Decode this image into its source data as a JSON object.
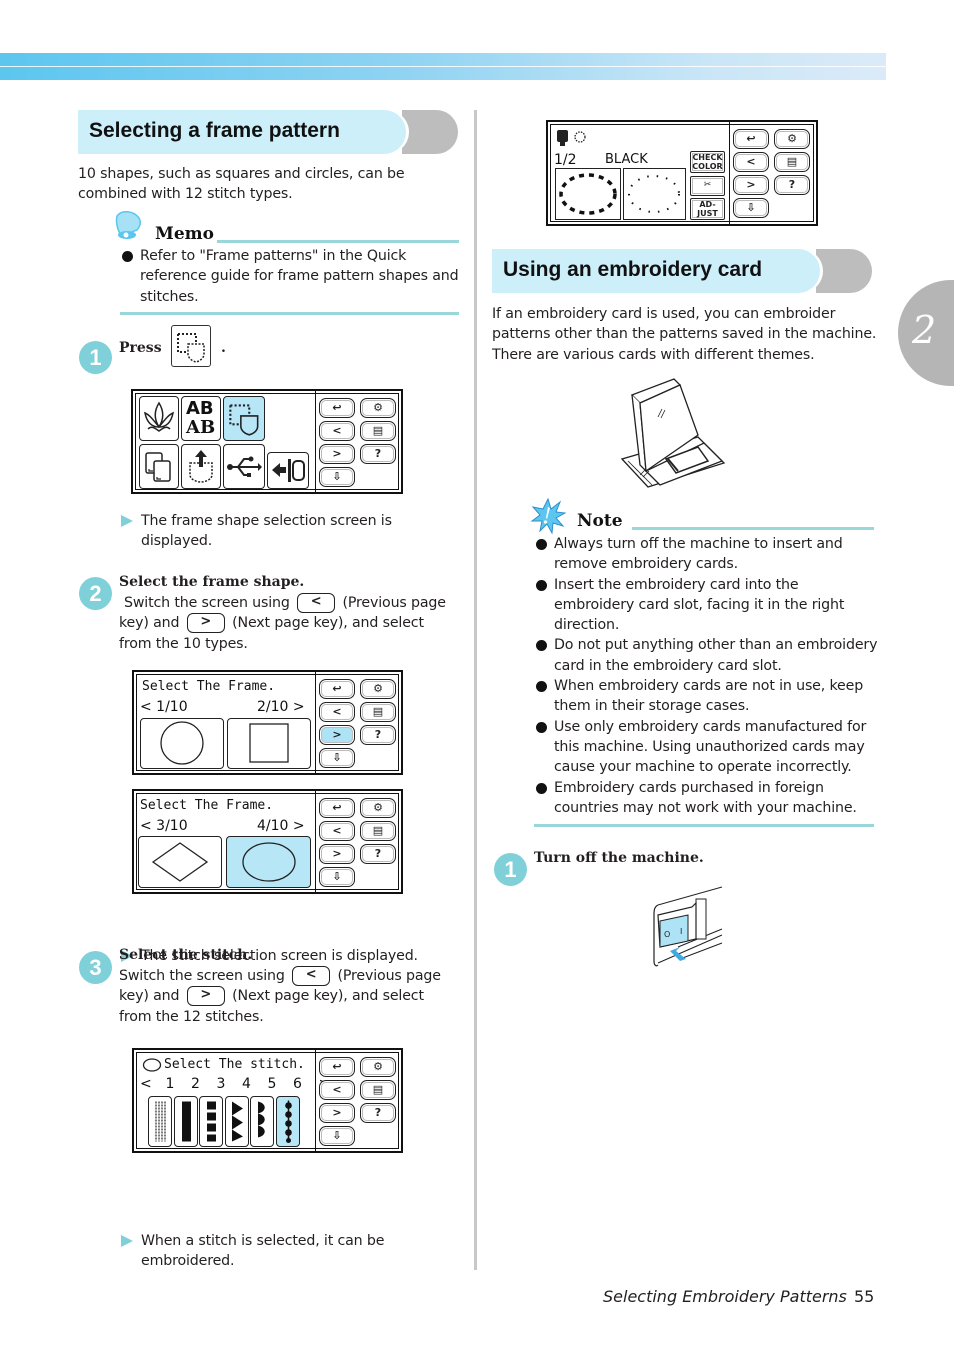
{
  "header": {
    "chapter_number": "2"
  },
  "left": {
    "section_title": "Selecting a frame pattern",
    "intro": "10 shapes, such as squares and circles, can be combined with 12 stitch types.",
    "memo": {
      "label": "Memo",
      "items": [
        "Refer to \"Frame patterns\" in the Quick reference guide for frame pattern shapes and stitches."
      ]
    },
    "step1": {
      "number": "1",
      "text_before": "Press",
      "text_after": ".",
      "result": "The frame shape selection screen is displayed."
    },
    "step2": {
      "number": "2",
      "title": "Select the frame shape.",
      "line1_before": "Switch the screen using",
      "line1_after": "(Previous page",
      "line2_before": "key) and",
      "line2_after": "(Next page key), and select",
      "line3": "from the 10 types.",
      "result": "The stitch selection screen is displayed."
    },
    "step3": {
      "number": "3",
      "title": "Select the stitch.",
      "line1_before": "Switch the screen using",
      "line1_after": "(Previous page",
      "line2_before": "key) and",
      "line2_after": "(Next page key), and select",
      "line3": "from the 12 stitches.",
      "result": "When a stitch is selected, it can be embroidered."
    }
  },
  "keys": {
    "prev": "<",
    "next": ">"
  },
  "screens": {
    "frame1": {
      "title": "Select The  Frame.",
      "left_page": "< 1/10",
      "right_page": "2/10 >"
    },
    "frame2": {
      "title": "Select The  Frame.",
      "left_page": "< 3/10",
      "right_page": "4/10 >"
    },
    "stitch": {
      "title": "Select The stitch.",
      "numbers": [
        "<",
        "1",
        "2",
        "3",
        "4",
        "5",
        "6",
        ">"
      ]
    },
    "color": {
      "page": "1/2",
      "color_name": "BLACK",
      "check_color": [
        "CHECK",
        "COLOR"
      ],
      "adjust": [
        "AD-",
        "JUST"
      ]
    },
    "menu_tile_text": [
      "AB",
      "AB"
    ]
  },
  "right": {
    "section_title": "Using an embroidery card",
    "intro": "If an embroidery card is used, you can embroider patterns other than the patterns saved in the machine. There are various cards with different themes.",
    "note": {
      "label": "Note",
      "items": [
        "Always turn off the machine to insert and remove embroidery cards.",
        "Insert the embroidery card into the embroidery card slot, facing it in the right direction.",
        "Do not put anything other than an embroidery card in the embroidery card slot.",
        "When embroidery cards are not in use, keep them in their storage cases.",
        "Use only embroidery cards manufactured for this machine. Using unauthorized cards may cause your machine to operate incorrectly.",
        "Embroidery cards purchased in foreign countries may not work with your machine."
      ]
    },
    "step1": {
      "number": "1",
      "title": "Turn off the machine.",
      "switch_labels": [
        "O",
        "I"
      ]
    }
  },
  "footer": {
    "section": "Selecting Embroidery Patterns",
    "page": "55"
  },
  "colors": {
    "accent_teal": "#7fd0d8",
    "header_blue": "#cdeffa",
    "selected_blue": "#b7e6f7",
    "rule": "#9ad7db"
  }
}
